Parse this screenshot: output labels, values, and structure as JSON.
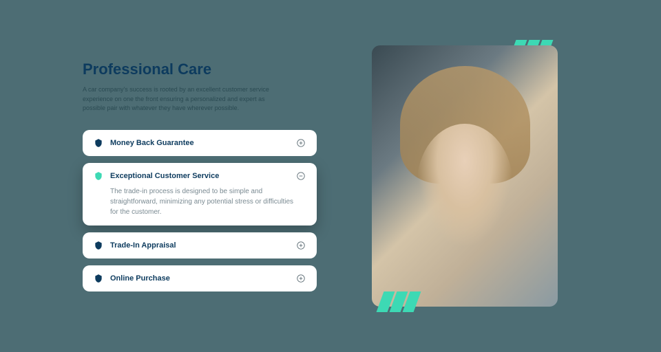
{
  "section": {
    "title": "Professional Care",
    "description": "A car company's success is rooted by an excellent customer service experience on one the front ensuring a personalized and expert as possible pair with whatever they have wherever possible."
  },
  "accordion": [
    {
      "title": "Money Back Guarantee",
      "expanded": false,
      "shield_color": "#0d3b5e"
    },
    {
      "title": "Exceptional Customer Service",
      "expanded": true,
      "shield_color": "#3dd9b4",
      "body": "The trade-in process is designed to be simple and straightforward, minimizing any potential stress or difficulties for the customer."
    },
    {
      "title": "Trade-In Appraisal",
      "expanded": false,
      "shield_color": "#0d3b5e"
    },
    {
      "title": "Online Purchase",
      "expanded": false,
      "shield_color": "#0d3b5e"
    }
  ],
  "colors": {
    "accent": "#3dd9b4",
    "primary": "#0d3b5e",
    "bg": "#4d6d74"
  }
}
